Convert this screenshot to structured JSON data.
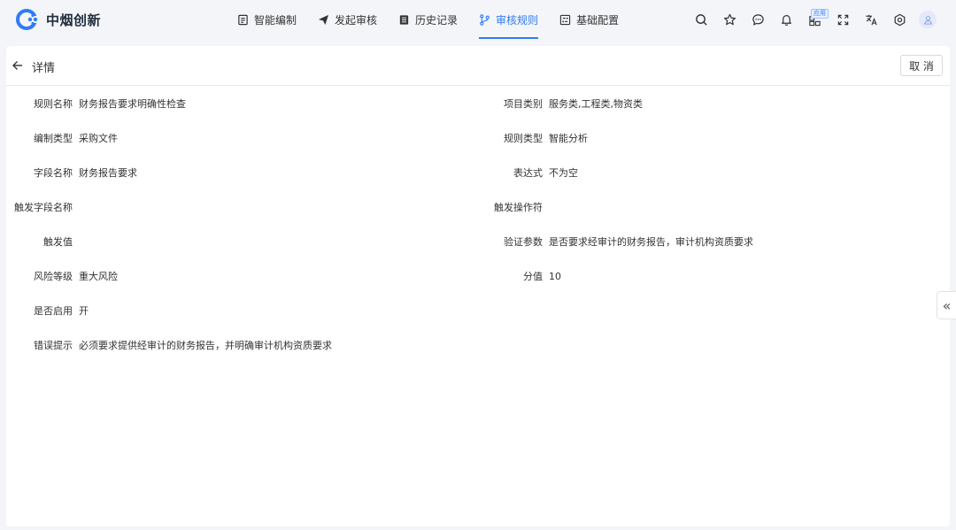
{
  "brand": {
    "name": "中烟创新",
    "accent": "#2f7bf6"
  },
  "nav": [
    {
      "label": "智能编制",
      "icon": "document-icon"
    },
    {
      "label": "发起审核",
      "icon": "send-icon"
    },
    {
      "label": "历史记录",
      "icon": "list-icon"
    },
    {
      "label": "审核规则",
      "icon": "branch-icon",
      "active": true
    },
    {
      "label": "基础配置",
      "icon": "config-icon"
    }
  ],
  "toolbar": {
    "app_badge": "应用",
    "icons": [
      "search-icon",
      "star-icon",
      "chat-icon",
      "bell-icon",
      "apps-icon",
      "fullscreen-icon",
      "translate-icon",
      "settings-icon",
      "user-avatar"
    ]
  },
  "detail": {
    "title": "详情",
    "cancel_label": "取 消",
    "left": [
      {
        "label": "规则名称",
        "value": "财务报告要求明确性检查"
      },
      {
        "label": "编制类型",
        "value": "采购文件"
      },
      {
        "label": "字段名称",
        "value": "财务报告要求"
      },
      {
        "label": "触发字段名称",
        "value": ""
      },
      {
        "label": "触发值",
        "value": ""
      },
      {
        "label": "风险等级",
        "value": "重大风险"
      },
      {
        "label": "是否启用",
        "value": "开"
      },
      {
        "label": "错误提示",
        "value": "必须要求提供经审计的财务报告，并明确审计机构资质要求"
      }
    ],
    "right": [
      {
        "label": "项目类别",
        "value": "服务类,工程类,物资类"
      },
      {
        "label": "规则类型",
        "value": "智能分析"
      },
      {
        "label": "表达式",
        "value": "不为空"
      },
      {
        "label": "触发操作符",
        "value": ""
      },
      {
        "label": "验证参数",
        "value": "是否要求经审计的财务报告，审计机构资质要求"
      },
      {
        "label": "分值",
        "value": "10"
      }
    ]
  },
  "side_toggle": "«"
}
